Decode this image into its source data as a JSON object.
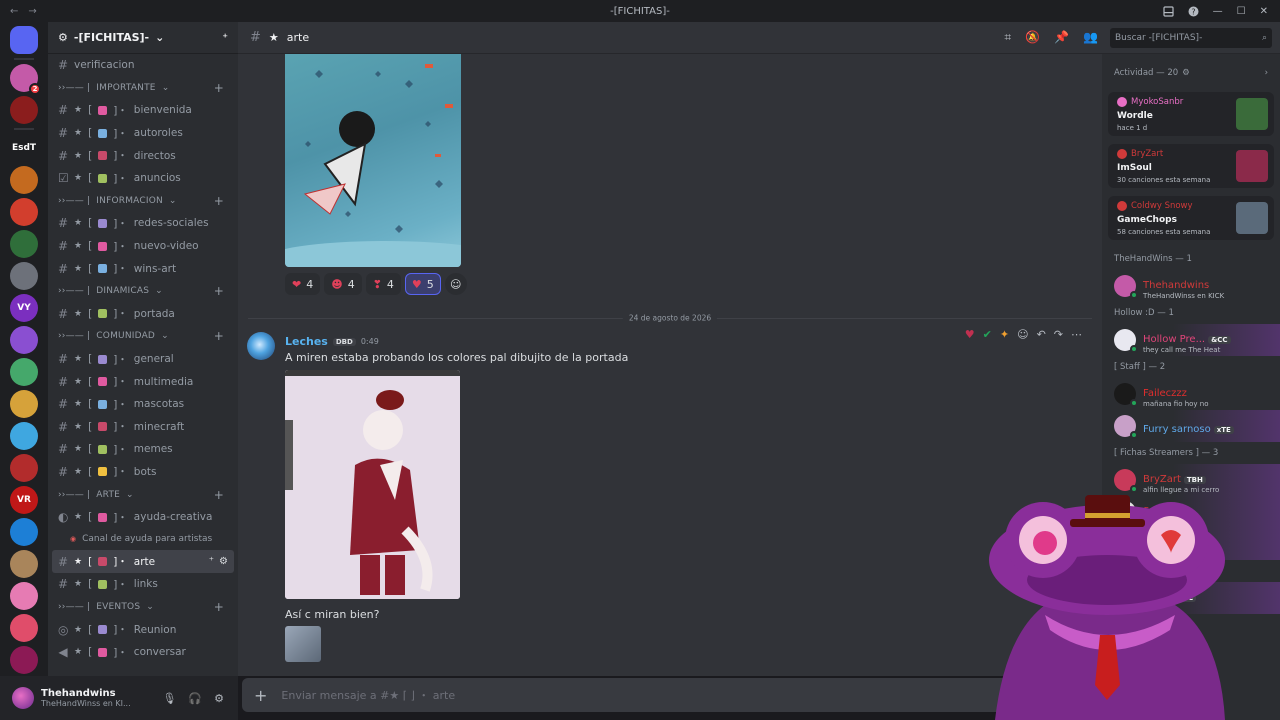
{
  "titlebar": {
    "title": "-[FICHITAS]-",
    "back": "←",
    "forward": "→"
  },
  "rail": {
    "servers": [
      {
        "label": "",
        "color": "#5865f2",
        "icon": "discord-icon"
      },
      {
        "label": "",
        "color": "#c45aa8",
        "badge": "2"
      },
      {
        "label": "",
        "color": "#8b1d1d"
      },
      {
        "label": "EsdT",
        "color": "#1e1f22"
      },
      {
        "label": "",
        "color": "#c46a1f"
      },
      {
        "label": "",
        "color": "#d23e2d"
      },
      {
        "label": "",
        "color": "#2f6e3a"
      },
      {
        "label": "",
        "color": "#6d717a"
      },
      {
        "label": "VY",
        "color": "#7b2fbf"
      },
      {
        "label": "",
        "color": "#8a4fd1"
      },
      {
        "label": "",
        "color": "#45a86b"
      },
      {
        "label": "",
        "color": "#d6a23a"
      },
      {
        "label": "",
        "color": "#3fa7e0"
      },
      {
        "label": "",
        "color": "#b22c2c"
      },
      {
        "label": "VR",
        "color": "#c01818"
      },
      {
        "label": "",
        "color": "#1d7fd6"
      },
      {
        "label": "",
        "color": "#a9855b"
      },
      {
        "label": "",
        "color": "#e67bb3"
      },
      {
        "label": "",
        "color": "#e04d6a"
      },
      {
        "label": "",
        "color": "#8c1a55"
      }
    ]
  },
  "guild": {
    "name": "-[FICHITAS]-"
  },
  "channels": [
    {
      "type": "channel",
      "name": "verificacion",
      "icon": "#"
    },
    {
      "type": "category",
      "name": "IMPORTANTE"
    },
    {
      "type": "channel",
      "name": "bienvenida",
      "icon": "#"
    },
    {
      "type": "channel",
      "name": "autoroles",
      "icon": "#"
    },
    {
      "type": "channel",
      "name": "directos",
      "icon": "#"
    },
    {
      "type": "channel",
      "name": "anuncios",
      "icon": "☑"
    },
    {
      "type": "category",
      "name": "INFORMACION"
    },
    {
      "type": "channel",
      "name": "redes-sociales",
      "icon": "#"
    },
    {
      "type": "channel",
      "name": "nuevo-video",
      "icon": "#"
    },
    {
      "type": "channel",
      "name": "wins-art",
      "icon": "#"
    },
    {
      "type": "category",
      "name": "DINAMICAS"
    },
    {
      "type": "channel",
      "name": "portada",
      "icon": "#"
    },
    {
      "type": "category",
      "name": "COMUNIDAD"
    },
    {
      "type": "channel",
      "name": "general",
      "icon": "#"
    },
    {
      "type": "channel",
      "name": "multimedia",
      "icon": "#"
    },
    {
      "type": "channel",
      "name": "mascotas",
      "icon": "#"
    },
    {
      "type": "channel",
      "name": "minecraft",
      "icon": "#"
    },
    {
      "type": "channel",
      "name": "memes",
      "icon": "#"
    },
    {
      "type": "channel",
      "name": "bots",
      "icon": "#"
    },
    {
      "type": "category",
      "name": "ARTE"
    },
    {
      "type": "channel",
      "name": "ayuda-creativa",
      "icon": "◐"
    },
    {
      "type": "thread",
      "name": "Canal de ayuda para artistas"
    },
    {
      "type": "channel",
      "name": "arte",
      "icon": "#",
      "active": true
    },
    {
      "type": "channel",
      "name": "links",
      "icon": "#"
    },
    {
      "type": "category",
      "name": "EVENTOS"
    },
    {
      "type": "channel",
      "name": "Reunion",
      "icon": "◎"
    },
    {
      "type": "channel",
      "name": "conversar",
      "icon": "◀"
    }
  ],
  "user": {
    "name": "Thehandwins",
    "status": "TheHandWinss en KI..."
  },
  "chat": {
    "channel_name": "arte",
    "reactions": [
      {
        "emoji": "❤",
        "count": "4"
      },
      {
        "emoji": "☻",
        "count": "4"
      },
      {
        "emoji": "❣",
        "count": "4"
      },
      {
        "emoji": "♥",
        "count": "5",
        "mine": true
      }
    ],
    "date_divider": "24 de agosto de 2026",
    "author": "Leches",
    "author_tag": "DBD",
    "time": "0:49",
    "message_text": "A miren estaba probando los colores pal dibujito de la portada",
    "followup_text": "Así c miran bien?",
    "composer_placeholder": "Enviar mensaje a #★ ⌈ ⌋ ・ arte"
  },
  "search": {
    "placeholder": "Buscar -[FICHITAS]-"
  },
  "members": {
    "activity_header": "Actividad — 20",
    "activities": [
      {
        "user": "MyokoSanbr",
        "user_color": "#e86fc5",
        "title": "Wordle",
        "sub": "hace 1 d",
        "art": "#3a6b3a"
      },
      {
        "user": "BryZart",
        "user_color": "#d03a3a",
        "title": "ImSoul",
        "sub": "30 canciones esta semana",
        "art": "#8b2a4a"
      },
      {
        "user": "Coldwy Snowy",
        "user_color": "#d03a3a",
        "title": "GameChops",
        "sub": "58 canciones esta semana",
        "art": "#5a6a7a"
      }
    ],
    "groups": [
      {
        "header": "TheHandWins — 1",
        "members": [
          {
            "name": "Thehandwins",
            "color": "#d03a3a",
            "status": "TheHandWinss en KICK",
            "ava": "#c45aa8"
          }
        ]
      },
      {
        "header": "Hollow :D — 1",
        "members": [
          {
            "name": "Hollow Pre...",
            "color": "#e0457a",
            "status": "they call me The Heat",
            "tag": "&CC",
            "ava": "#e8e8f0",
            "boost": true
          }
        ]
      },
      {
        "header": "[ Staff ] — 2",
        "members": [
          {
            "name": "Faileczzz",
            "color": "#e02e2e",
            "status": "mañana fio hoy no",
            "ava": "#1a1a1a"
          },
          {
            "name": "Furry sarnoso",
            "color": "#5fa8e8",
            "status": "",
            "tag": "xTE",
            "ava": "#c8a0c8",
            "boost": true
          }
        ]
      },
      {
        "header": "[ Fichas Streamers ] — 3",
        "members": [
          {
            "name": "BryZart",
            "color": "#d03a3a",
            "status": "alfin llegue a mi cerro",
            "tag": "TBH",
            "ava": "#c83a5a",
            "boost": true
          },
          {
            "name": "Snowy",
            "color": "#d03a3a",
            "status": "fes de las pers...",
            "ava": "#e0e0e0",
            "boost": true
          },
          {
            "name": "",
            "color": "#d03a3a",
            "status": "",
            "ava": "#7a4ab0",
            "boost": true
          }
        ]
      },
      {
        "header": "",
        "members": [
          {
            "name": "...sus",
            "color": "#d03a3a",
            "status": "Fortnite",
            "tag": "DMC",
            "ava": "#d0a030",
            "boost": true
          }
        ]
      }
    ]
  }
}
